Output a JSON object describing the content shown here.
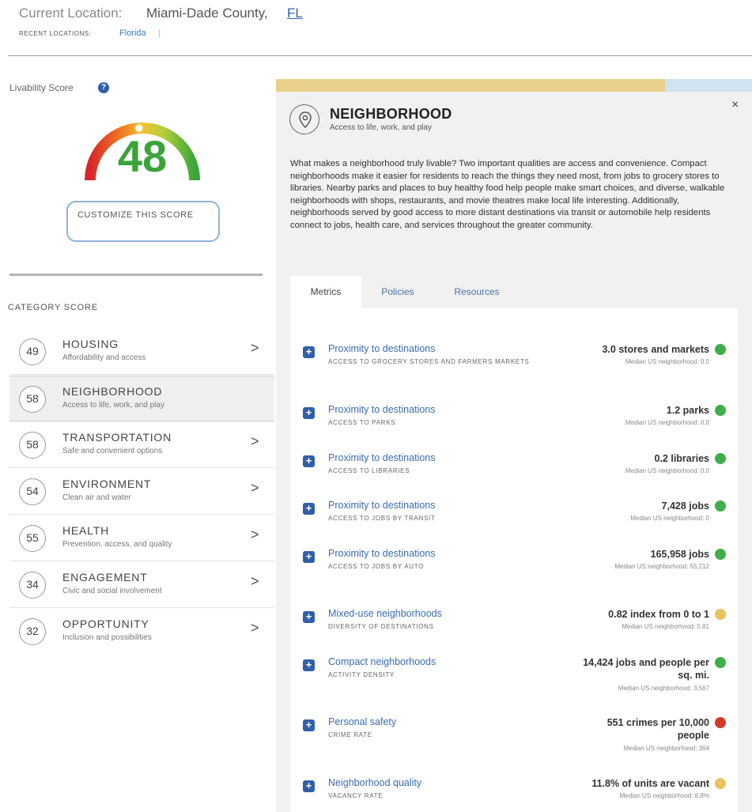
{
  "header": {
    "current_location_label": "Current Location:",
    "current_location_value": "Miami-Dade County,",
    "current_location_state": "FL",
    "recent_label": "RECENT LOCATIONS:",
    "recent_link": "Florida",
    "recent_separator": "|"
  },
  "score": {
    "label": "Livability Score",
    "help_icon": "?",
    "value": "48",
    "value_number": 48,
    "customize_label": "CUSTOMIZE THIS SCORE"
  },
  "categories": {
    "title": "CATEGORY SCORE",
    "items": [
      {
        "score": "49",
        "name": "HOUSING",
        "sub": "Affordability and access",
        "chevron": ">"
      },
      {
        "score": "58",
        "name": "NEIGHBORHOOD",
        "sub": "Access to life, work, and play",
        "chevron": ""
      },
      {
        "score": "58",
        "name": "TRANSPORTATION",
        "sub": "Safe and convenient options",
        "chevron": ">"
      },
      {
        "score": "54",
        "name": "ENVIRONMENT",
        "sub": "Clean air and water",
        "chevron": ">"
      },
      {
        "score": "55",
        "name": "HEALTH",
        "sub": "Prevention, access, and quality",
        "chevron": ">"
      },
      {
        "score": "34",
        "name": "ENGAGEMENT",
        "sub": "Civic and social involvement",
        "chevron": ">"
      },
      {
        "score": "32",
        "name": "OPPORTUNITY",
        "sub": "Inclusion and possibilities",
        "chevron": ">"
      }
    ]
  },
  "panel": {
    "title": "NEIGHBORHOOD",
    "subtitle": "Access to life, work, and play",
    "close": "×",
    "description": "What makes a neighborhood truly livable? Two important qualities are access and convenience. Compact neighborhoods make it easier for residents to reach the things they need most, from jobs to grocery stores to libraries. Nearby parks and places to buy healthy food help people make smart choices, and diverse, walkable neighborhoods with shops, restaurants, and movie theatres make local life interesting. Additionally, neighborhoods served by good access to more distant destinations via transit or automobile help residents connect to jobs, health care, and services throughout the greater community.",
    "tabs": [
      "Metrics",
      "Policies",
      "Resources"
    ]
  },
  "metrics": [
    {
      "title": "Proximity to destinations",
      "sub": "ACCESS TO GROCERY STORES AND FARMERS MARKETS",
      "value": "3.0 stores and markets",
      "median": "Median US neighborhood: 0.0",
      "status": "green"
    },
    {
      "title": "Proximity to destinations",
      "sub": "ACCESS TO PARKS",
      "value": "1.2 parks",
      "median": "Median US neighborhood: 0.0",
      "status": "green"
    },
    {
      "title": "Proximity to destinations",
      "sub": "ACCESS TO LIBRARIES",
      "value": "0.2 libraries",
      "median": "Median US neighborhood: 0.0",
      "status": "green"
    },
    {
      "title": "Proximity to destinations",
      "sub": "ACCESS TO JOBS BY TRANSIT",
      "value": "7,428 jobs",
      "median": "Median US neighborhood: 0",
      "status": "green"
    },
    {
      "title": "Proximity to destinations",
      "sub": "ACCESS TO JOBS BY AUTO",
      "value": "165,958 jobs",
      "median": "Median US neighborhood: 55,212",
      "status": "green"
    },
    {
      "title": "Mixed-use neighborhoods",
      "sub": "DIVERSITY OF DESTINATIONS",
      "value": "0.82 index from 0 to 1",
      "median": "Median US neighborhood: 0.81",
      "status": "yellow"
    },
    {
      "title": "Compact neighborhoods",
      "sub": "ACTIVITY DENSITY",
      "value": "14,424 jobs and people per sq. mi.",
      "median": "Median US neighborhood: 3,567",
      "status": "green"
    },
    {
      "title": "Personal safety",
      "sub": "CRIME RATE",
      "value": "551 crimes per 10,000 people",
      "median": "Median US neighborhood: 364",
      "status": "red"
    },
    {
      "title": "Neighborhood quality",
      "sub": "VACANCY RATE",
      "value": "11.8% of units are vacant",
      "median": "Median US neighborhood: 8.8%",
      "status": "yellow"
    }
  ],
  "colors": {
    "green": "#3fae49",
    "yellow": "#e8c25e",
    "red": "#d33a2c",
    "accent": "#2f5fa8",
    "link": "#3a6cb0"
  }
}
